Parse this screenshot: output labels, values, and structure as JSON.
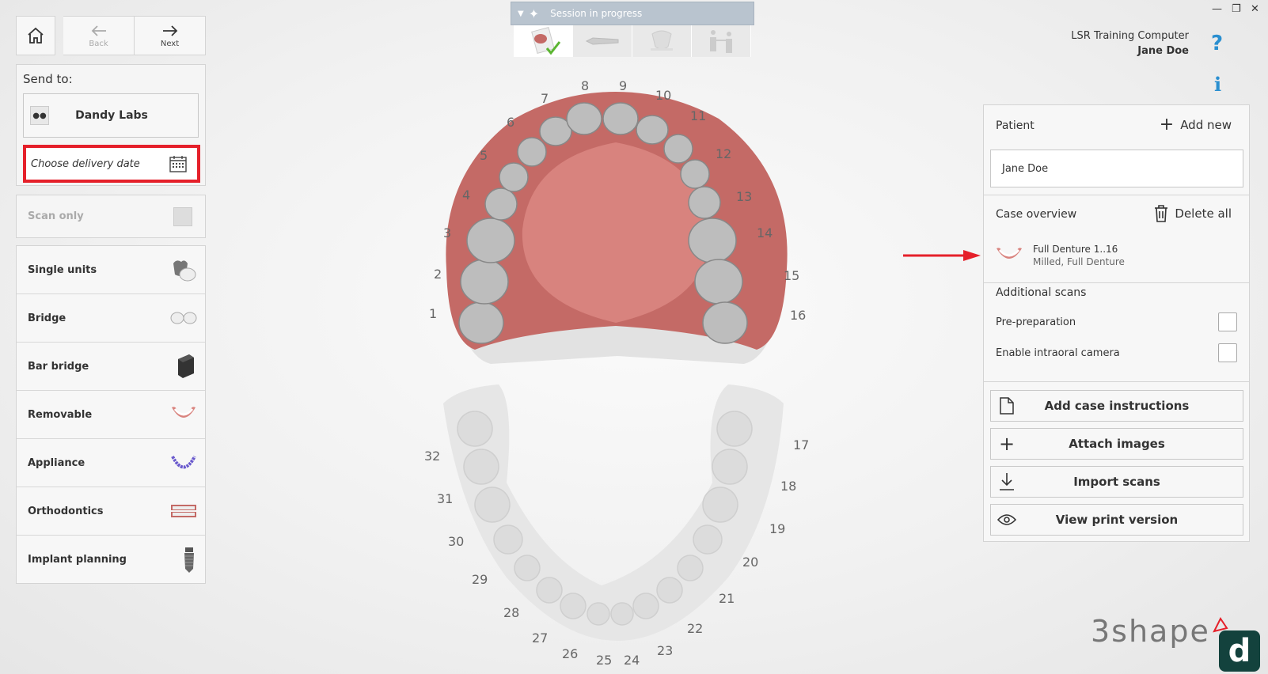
{
  "nav": {
    "back_label": "Back",
    "next_label": "Next"
  },
  "send_to": {
    "label": "Send to:",
    "lab_name": "Dandy Labs",
    "delivery_placeholder": "Choose delivery date"
  },
  "scan_only": {
    "label": "Scan only"
  },
  "indication_types": [
    {
      "label": "Single units",
      "icon": "crown-icon"
    },
    {
      "label": "Bridge",
      "icon": "bridge-icon"
    },
    {
      "label": "Bar bridge",
      "icon": "bar-bridge-icon"
    },
    {
      "label": "Removable",
      "icon": "denture-icon"
    },
    {
      "label": "Appliance",
      "icon": "appliance-icon"
    },
    {
      "label": "Orthodontics",
      "icon": "orthodontics-icon"
    },
    {
      "label": "Implant planning",
      "icon": "implant-icon"
    }
  ],
  "session": {
    "label": "Session in progress"
  },
  "user": {
    "computer": "LSR Training Computer",
    "name": "Jane Doe"
  },
  "patient": {
    "title": "Patient",
    "add_new": "Add new",
    "name": "Jane Doe"
  },
  "case_overview": {
    "title": "Case overview",
    "delete_all": "Delete all",
    "item_title": "Full Denture  1..16",
    "item_subtitle": "Milled, Full Denture"
  },
  "additional_scans": {
    "title": "Additional scans",
    "pre_preparation": "Pre-preparation",
    "intraoral_camera": "Enable intraoral camera"
  },
  "actions": {
    "add_instructions": "Add case instructions",
    "attach_images": "Attach images",
    "import_scans": "Import scans",
    "view_print": "View print version"
  },
  "brand": {
    "name": "3shape",
    "logo_letter": "d"
  },
  "icons": {
    "help": "?",
    "info": "i"
  },
  "upper_teeth_numbers": [
    "1",
    "2",
    "3",
    "4",
    "5",
    "6",
    "7",
    "8",
    "9",
    "10",
    "11",
    "12",
    "13",
    "14",
    "15",
    "16"
  ],
  "lower_teeth_numbers": [
    "17",
    "18",
    "19",
    "20",
    "21",
    "22",
    "23",
    "24",
    "25",
    "26",
    "27",
    "28",
    "29",
    "30",
    "31",
    "32"
  ],
  "colors": {
    "accent": "#2a8fd0",
    "highlight": "#e5202a",
    "gum": "#c76e6a"
  }
}
